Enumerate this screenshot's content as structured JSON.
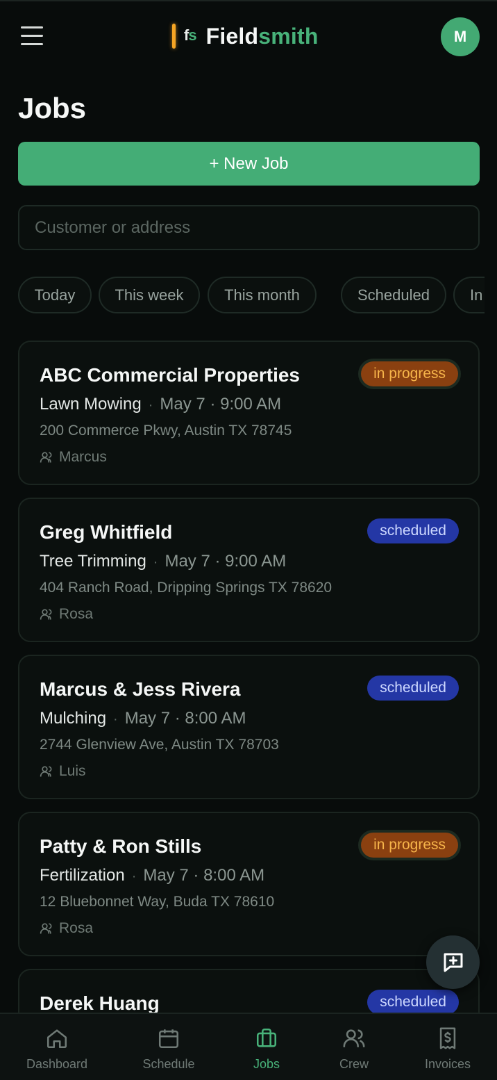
{
  "app": {
    "logo_mark": "f",
    "logo_mark_accent": "s",
    "name_primary": "Field",
    "name_accent": "smith",
    "avatar_initial": "M"
  },
  "page": {
    "title": "Jobs",
    "new_job_label": "+ New Job",
    "search_placeholder": "Customer or address"
  },
  "filters": [
    "Today",
    "This week",
    "This month",
    "Scheduled",
    "In"
  ],
  "jobs": [
    {
      "customer": "ABC Commercial Properties",
      "service": "Lawn Mowing",
      "when": "May 7 · 9:00 AM",
      "address": "200 Commerce Pkwy, Austin TX 78745",
      "crew": "Marcus",
      "status": "in progress"
    },
    {
      "customer": "Greg Whitfield",
      "service": "Tree Trimming",
      "when": "May 7 · 9:00 AM",
      "address": "404 Ranch Road, Dripping Springs TX 78620",
      "crew": "Rosa",
      "status": "scheduled"
    },
    {
      "customer": "Marcus & Jess Rivera",
      "service": "Mulching",
      "when": "May 7 · 8:00 AM",
      "address": "2744 Glenview Ave, Austin TX 78703",
      "crew": "Luis",
      "status": "scheduled"
    },
    {
      "customer": "Patty & Ron Stills",
      "service": "Fertilization",
      "when": "May 7 · 8:00 AM",
      "address": "12 Bluebonnet Way, Buda TX 78610",
      "crew": "Rosa",
      "status": "in progress"
    },
    {
      "customer": "Derek Huang",
      "status": "scheduled"
    }
  ],
  "nav": [
    {
      "label": "Dashboard",
      "icon": "home-icon"
    },
    {
      "label": "Schedule",
      "icon": "calendar-icon"
    },
    {
      "label": "Jobs",
      "icon": "briefcase-icon",
      "active": true
    },
    {
      "label": "Crew",
      "icon": "users-icon"
    },
    {
      "label": "Invoices",
      "icon": "receipt-icon"
    }
  ],
  "colors": {
    "accent": "#44ad76",
    "in_progress_bg": "#8a4010",
    "in_progress_text": "#f6b44a",
    "scheduled_bg": "#2437a5",
    "scheduled_text": "#cdd8ff"
  }
}
